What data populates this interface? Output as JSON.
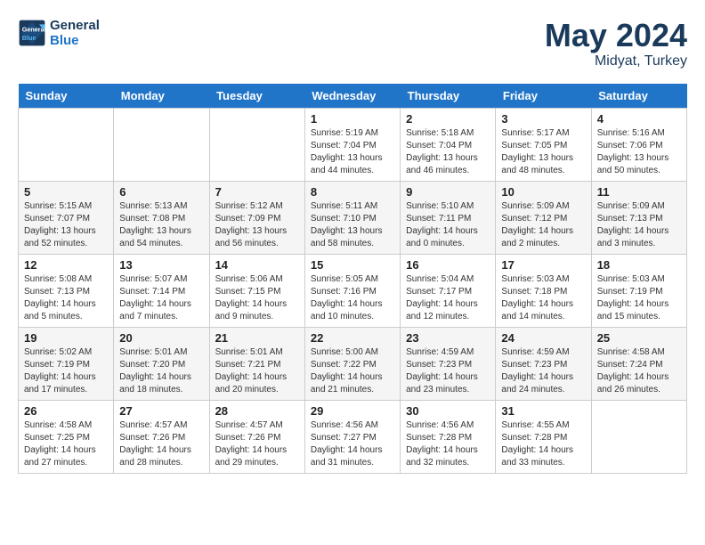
{
  "header": {
    "logo_line1": "General",
    "logo_line2": "Blue",
    "month_year": "May 2024",
    "location": "Midyat, Turkey"
  },
  "days_of_week": [
    "Sunday",
    "Monday",
    "Tuesday",
    "Wednesday",
    "Thursday",
    "Friday",
    "Saturday"
  ],
  "weeks": [
    [
      {
        "day": "",
        "sunrise": "",
        "sunset": "",
        "daylight": ""
      },
      {
        "day": "",
        "sunrise": "",
        "sunset": "",
        "daylight": ""
      },
      {
        "day": "",
        "sunrise": "",
        "sunset": "",
        "daylight": ""
      },
      {
        "day": "1",
        "sunrise": "Sunrise: 5:19 AM",
        "sunset": "Sunset: 7:04 PM",
        "daylight": "Daylight: 13 hours and 44 minutes."
      },
      {
        "day": "2",
        "sunrise": "Sunrise: 5:18 AM",
        "sunset": "Sunset: 7:04 PM",
        "daylight": "Daylight: 13 hours and 46 minutes."
      },
      {
        "day": "3",
        "sunrise": "Sunrise: 5:17 AM",
        "sunset": "Sunset: 7:05 PM",
        "daylight": "Daylight: 13 hours and 48 minutes."
      },
      {
        "day": "4",
        "sunrise": "Sunrise: 5:16 AM",
        "sunset": "Sunset: 7:06 PM",
        "daylight": "Daylight: 13 hours and 50 minutes."
      }
    ],
    [
      {
        "day": "5",
        "sunrise": "Sunrise: 5:15 AM",
        "sunset": "Sunset: 7:07 PM",
        "daylight": "Daylight: 13 hours and 52 minutes."
      },
      {
        "day": "6",
        "sunrise": "Sunrise: 5:13 AM",
        "sunset": "Sunset: 7:08 PM",
        "daylight": "Daylight: 13 hours and 54 minutes."
      },
      {
        "day": "7",
        "sunrise": "Sunrise: 5:12 AM",
        "sunset": "Sunset: 7:09 PM",
        "daylight": "Daylight: 13 hours and 56 minutes."
      },
      {
        "day": "8",
        "sunrise": "Sunrise: 5:11 AM",
        "sunset": "Sunset: 7:10 PM",
        "daylight": "Daylight: 13 hours and 58 minutes."
      },
      {
        "day": "9",
        "sunrise": "Sunrise: 5:10 AM",
        "sunset": "Sunset: 7:11 PM",
        "daylight": "Daylight: 14 hours and 0 minutes."
      },
      {
        "day": "10",
        "sunrise": "Sunrise: 5:09 AM",
        "sunset": "Sunset: 7:12 PM",
        "daylight": "Daylight: 14 hours and 2 minutes."
      },
      {
        "day": "11",
        "sunrise": "Sunrise: 5:09 AM",
        "sunset": "Sunset: 7:13 PM",
        "daylight": "Daylight: 14 hours and 3 minutes."
      }
    ],
    [
      {
        "day": "12",
        "sunrise": "Sunrise: 5:08 AM",
        "sunset": "Sunset: 7:13 PM",
        "daylight": "Daylight: 14 hours and 5 minutes."
      },
      {
        "day": "13",
        "sunrise": "Sunrise: 5:07 AM",
        "sunset": "Sunset: 7:14 PM",
        "daylight": "Daylight: 14 hours and 7 minutes."
      },
      {
        "day": "14",
        "sunrise": "Sunrise: 5:06 AM",
        "sunset": "Sunset: 7:15 PM",
        "daylight": "Daylight: 14 hours and 9 minutes."
      },
      {
        "day": "15",
        "sunrise": "Sunrise: 5:05 AM",
        "sunset": "Sunset: 7:16 PM",
        "daylight": "Daylight: 14 hours and 10 minutes."
      },
      {
        "day": "16",
        "sunrise": "Sunrise: 5:04 AM",
        "sunset": "Sunset: 7:17 PM",
        "daylight": "Daylight: 14 hours and 12 minutes."
      },
      {
        "day": "17",
        "sunrise": "Sunrise: 5:03 AM",
        "sunset": "Sunset: 7:18 PM",
        "daylight": "Daylight: 14 hours and 14 minutes."
      },
      {
        "day": "18",
        "sunrise": "Sunrise: 5:03 AM",
        "sunset": "Sunset: 7:19 PM",
        "daylight": "Daylight: 14 hours and 15 minutes."
      }
    ],
    [
      {
        "day": "19",
        "sunrise": "Sunrise: 5:02 AM",
        "sunset": "Sunset: 7:19 PM",
        "daylight": "Daylight: 14 hours and 17 minutes."
      },
      {
        "day": "20",
        "sunrise": "Sunrise: 5:01 AM",
        "sunset": "Sunset: 7:20 PM",
        "daylight": "Daylight: 14 hours and 18 minutes."
      },
      {
        "day": "21",
        "sunrise": "Sunrise: 5:01 AM",
        "sunset": "Sunset: 7:21 PM",
        "daylight": "Daylight: 14 hours and 20 minutes."
      },
      {
        "day": "22",
        "sunrise": "Sunrise: 5:00 AM",
        "sunset": "Sunset: 7:22 PM",
        "daylight": "Daylight: 14 hours and 21 minutes."
      },
      {
        "day": "23",
        "sunrise": "Sunrise: 4:59 AM",
        "sunset": "Sunset: 7:23 PM",
        "daylight": "Daylight: 14 hours and 23 minutes."
      },
      {
        "day": "24",
        "sunrise": "Sunrise: 4:59 AM",
        "sunset": "Sunset: 7:23 PM",
        "daylight": "Daylight: 14 hours and 24 minutes."
      },
      {
        "day": "25",
        "sunrise": "Sunrise: 4:58 AM",
        "sunset": "Sunset: 7:24 PM",
        "daylight": "Daylight: 14 hours and 26 minutes."
      }
    ],
    [
      {
        "day": "26",
        "sunrise": "Sunrise: 4:58 AM",
        "sunset": "Sunset: 7:25 PM",
        "daylight": "Daylight: 14 hours and 27 minutes."
      },
      {
        "day": "27",
        "sunrise": "Sunrise: 4:57 AM",
        "sunset": "Sunset: 7:26 PM",
        "daylight": "Daylight: 14 hours and 28 minutes."
      },
      {
        "day": "28",
        "sunrise": "Sunrise: 4:57 AM",
        "sunset": "Sunset: 7:26 PM",
        "daylight": "Daylight: 14 hours and 29 minutes."
      },
      {
        "day": "29",
        "sunrise": "Sunrise: 4:56 AM",
        "sunset": "Sunset: 7:27 PM",
        "daylight": "Daylight: 14 hours and 31 minutes."
      },
      {
        "day": "30",
        "sunrise": "Sunrise: 4:56 AM",
        "sunset": "Sunset: 7:28 PM",
        "daylight": "Daylight: 14 hours and 32 minutes."
      },
      {
        "day": "31",
        "sunrise": "Sunrise: 4:55 AM",
        "sunset": "Sunset: 7:28 PM",
        "daylight": "Daylight: 14 hours and 33 minutes."
      },
      {
        "day": "",
        "sunrise": "",
        "sunset": "",
        "daylight": ""
      }
    ]
  ]
}
